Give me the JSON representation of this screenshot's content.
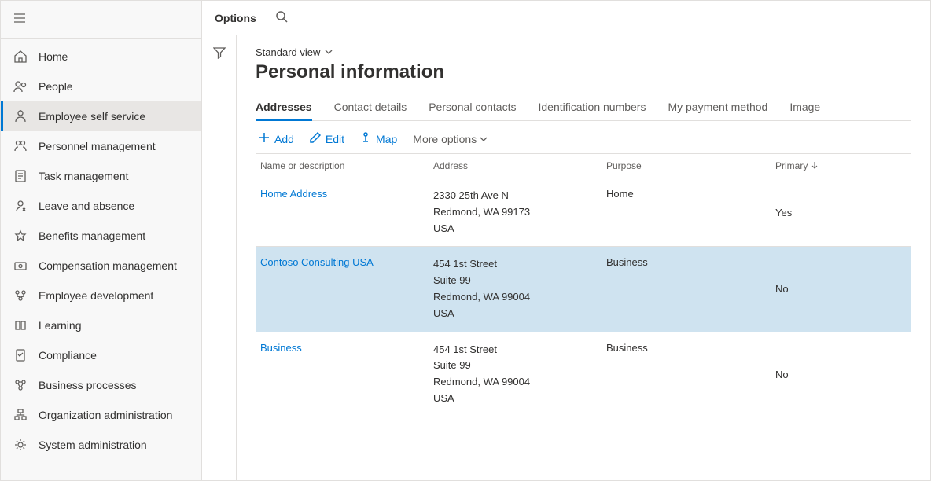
{
  "topbar": {
    "options": "Options"
  },
  "sidebar": {
    "items": [
      {
        "label": "Home",
        "icon": "home",
        "active": false
      },
      {
        "label": "People",
        "icon": "people",
        "active": false
      },
      {
        "label": "Employee self service",
        "icon": "self-service",
        "active": true
      },
      {
        "label": "Personnel management",
        "icon": "personnel",
        "active": false
      },
      {
        "label": "Task management",
        "icon": "task",
        "active": false
      },
      {
        "label": "Leave and absence",
        "icon": "leave",
        "active": false
      },
      {
        "label": "Benefits management",
        "icon": "benefits",
        "active": false
      },
      {
        "label": "Compensation management",
        "icon": "compensation",
        "active": false
      },
      {
        "label": "Employee development",
        "icon": "development",
        "active": false
      },
      {
        "label": "Learning",
        "icon": "learning",
        "active": false
      },
      {
        "label": "Compliance",
        "icon": "compliance",
        "active": false
      },
      {
        "label": "Business processes",
        "icon": "processes",
        "active": false
      },
      {
        "label": "Organization administration",
        "icon": "org",
        "active": false
      },
      {
        "label": "System administration",
        "icon": "system",
        "active": false
      }
    ]
  },
  "view": {
    "label": "Standard view"
  },
  "page": {
    "title": "Personal information"
  },
  "tabs": [
    {
      "label": "Addresses",
      "active": true
    },
    {
      "label": "Contact details",
      "active": false
    },
    {
      "label": "Personal contacts",
      "active": false
    },
    {
      "label": "Identification numbers",
      "active": false
    },
    {
      "label": "My payment method",
      "active": false
    },
    {
      "label": "Image",
      "active": false
    }
  ],
  "toolbar": {
    "add": "Add",
    "edit": "Edit",
    "map": "Map",
    "more": "More options"
  },
  "grid": {
    "headers": {
      "name": "Name or description",
      "address": "Address",
      "purpose": "Purpose",
      "primary": "Primary"
    },
    "rows": [
      {
        "name": "Home Address",
        "address": "2330 25th Ave N\nRedmond, WA 99173\nUSA",
        "purpose": "Home",
        "primary": "Yes",
        "selected": false
      },
      {
        "name": "Contoso Consulting USA",
        "address": "454 1st Street\nSuite 99\nRedmond, WA 99004\nUSA",
        "purpose": "Business",
        "primary": "No",
        "selected": true
      },
      {
        "name": "Business",
        "address": "454 1st Street\nSuite 99\nRedmond, WA 99004\nUSA",
        "purpose": "Business",
        "primary": "No",
        "selected": false
      }
    ]
  },
  "colors": {
    "accent": "#0078d4"
  }
}
